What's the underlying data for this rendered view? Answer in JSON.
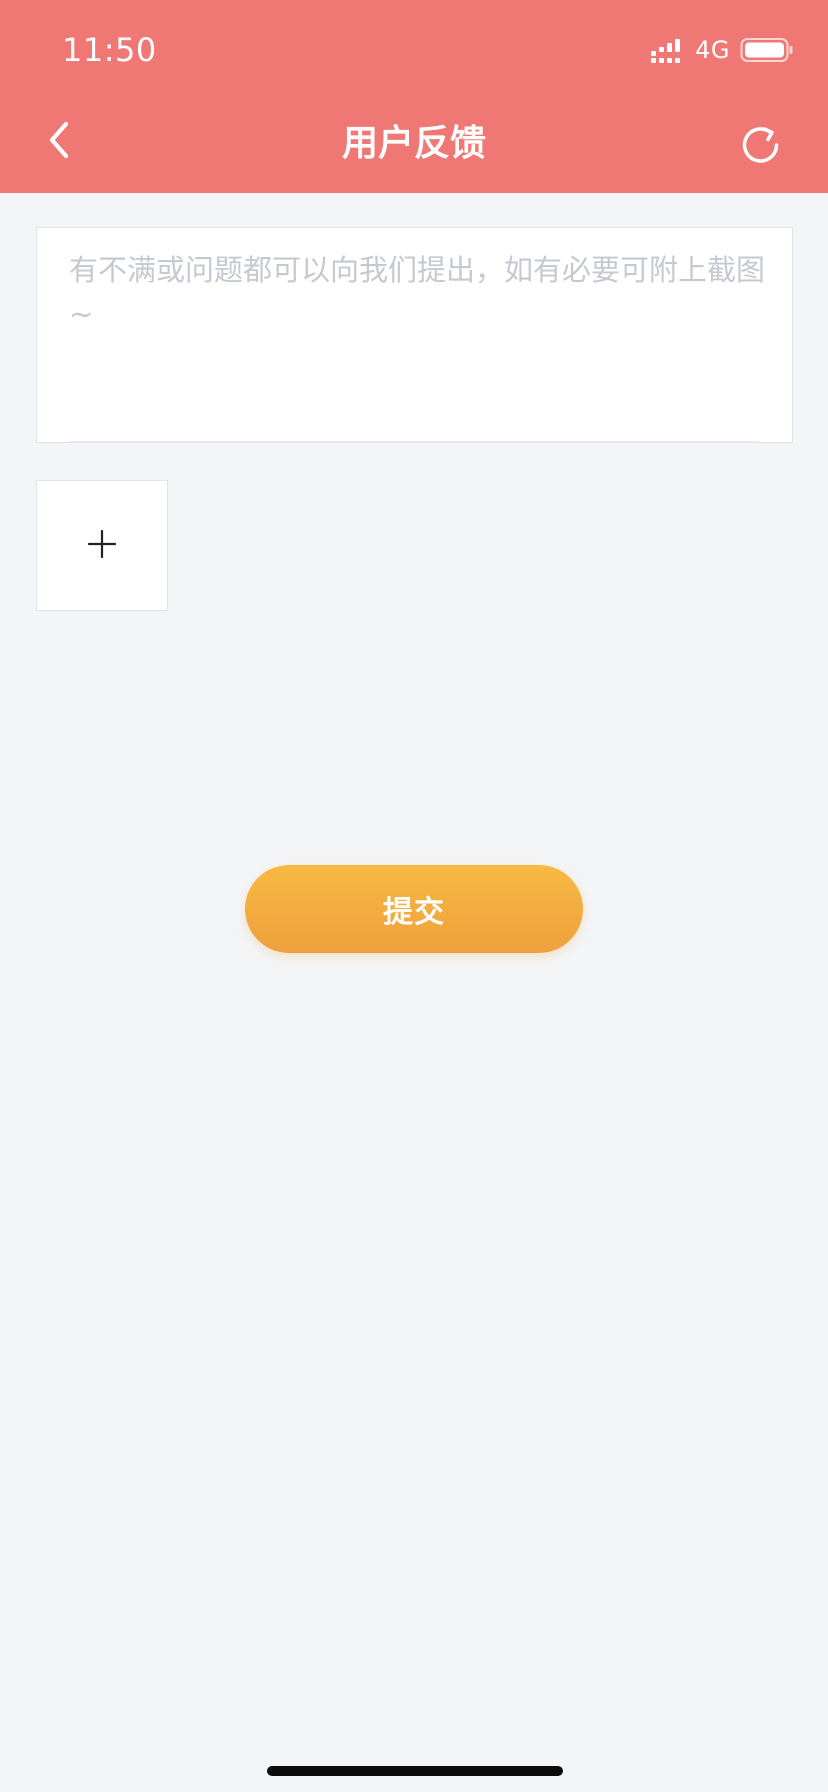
{
  "status_bar": {
    "time": "11:50",
    "network": "4G",
    "icons": [
      "signal-icon",
      "battery-icon"
    ]
  },
  "nav": {
    "title": "用户反馈",
    "back_icon": "chevron-left-icon",
    "refresh_icon": "refresh-icon"
  },
  "feedback": {
    "placeholder": "有不满或问题都可以向我们提出，如有必要可附上截图~",
    "value": ""
  },
  "upload": {
    "icon": "plus-icon"
  },
  "actions": {
    "submit_label": "提交"
  },
  "colors": {
    "header_bg": "#ef7774",
    "page_bg": "#f4f5f7",
    "button_gradient_top": "#f6ba43",
    "button_gradient_bottom": "#efa03d",
    "placeholder": "#c6c9cf"
  }
}
